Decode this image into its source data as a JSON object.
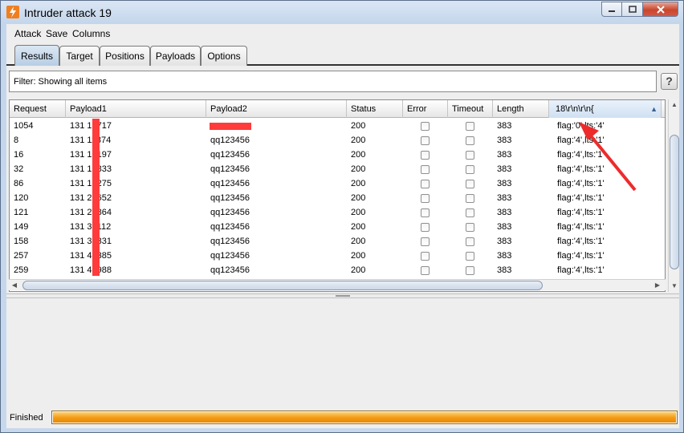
{
  "window": {
    "title": "Intruder attack 19",
    "icon": "burp-intruder-icon",
    "controls": [
      "minimize-icon",
      "maximize-icon",
      "close-icon"
    ]
  },
  "menu": [
    "Attack",
    "Save",
    "Columns"
  ],
  "tabs": [
    {
      "label": "Results",
      "active": true
    },
    {
      "label": "Target",
      "active": false
    },
    {
      "label": "Positions",
      "active": false
    },
    {
      "label": "Payloads",
      "active": false
    },
    {
      "label": "Options",
      "active": false
    }
  ],
  "filter": {
    "text": "Filter:  Showing all items",
    "help": "?"
  },
  "table": {
    "columns": [
      "Request",
      "Payload1",
      "Payload2",
      "Status",
      "Error",
      "Timeout",
      "Length",
      "18\\r\\n\\r\\n{"
    ],
    "sorted_column": "18\\r\\n\\r\\n{",
    "rows": [
      {
        "request": "1054",
        "payload1": "131        17717",
        "payload2": "",
        "status": "200",
        "error": false,
        "timeout": false,
        "length": "383",
        "grep": "flag:'0',lts:'4'"
      },
      {
        "request": "8",
        "payload1": "131        11874",
        "payload2": "qq123456",
        "status": "200",
        "error": false,
        "timeout": false,
        "length": "383",
        "grep": "flag:'4',lts:'1'"
      },
      {
        "request": "16",
        "payload1": "131        12197",
        "payload2": "qq123456",
        "status": "200",
        "error": false,
        "timeout": false,
        "length": "383",
        "grep": "flag:'4',lts:'1'"
      },
      {
        "request": "32",
        "payload1": "131        12833",
        "payload2": "qq123456",
        "status": "200",
        "error": false,
        "timeout": false,
        "length": "383",
        "grep": "flag:'4',lts:'1'"
      },
      {
        "request": "86",
        "payload1": "131        19275",
        "payload2": "qq123456",
        "status": "200",
        "error": false,
        "timeout": false,
        "length": "383",
        "grep": "flag:'4',lts:'1'"
      },
      {
        "request": "120",
        "payload1": "131        28652",
        "payload2": "qq123456",
        "status": "200",
        "error": false,
        "timeout": false,
        "length": "383",
        "grep": "flag:'4',lts:'1'"
      },
      {
        "request": "121",
        "payload1": "131        28864",
        "payload2": "qq123456",
        "status": "200",
        "error": false,
        "timeout": false,
        "length": "383",
        "grep": "flag:'4',lts:'1'"
      },
      {
        "request": "149",
        "payload1": "131        32112",
        "payload2": "qq123456",
        "status": "200",
        "error": false,
        "timeout": false,
        "length": "383",
        "grep": "flag:'4',lts:'1'"
      },
      {
        "request": "158",
        "payload1": "131        33331",
        "payload2": "qq123456",
        "status": "200",
        "error": false,
        "timeout": false,
        "length": "383",
        "grep": "flag:'4',lts:'1'"
      },
      {
        "request": "257",
        "payload1": "131        49385",
        "payload2": "qq123456",
        "status": "200",
        "error": false,
        "timeout": false,
        "length": "383",
        "grep": "flag:'4',lts:'1'"
      },
      {
        "request": "259",
        "payload1": "131        49988",
        "payload2": "qq123456",
        "status": "200",
        "error": false,
        "timeout": false,
        "length": "383",
        "grep": "flag:'4',lts:'1'"
      }
    ]
  },
  "status": {
    "label": "Finished",
    "progress": 1.0
  },
  "colors": {
    "redaction": "#ff3b3b",
    "annotation_arrow": "#ee2b2b",
    "progress": "#f39a12"
  }
}
